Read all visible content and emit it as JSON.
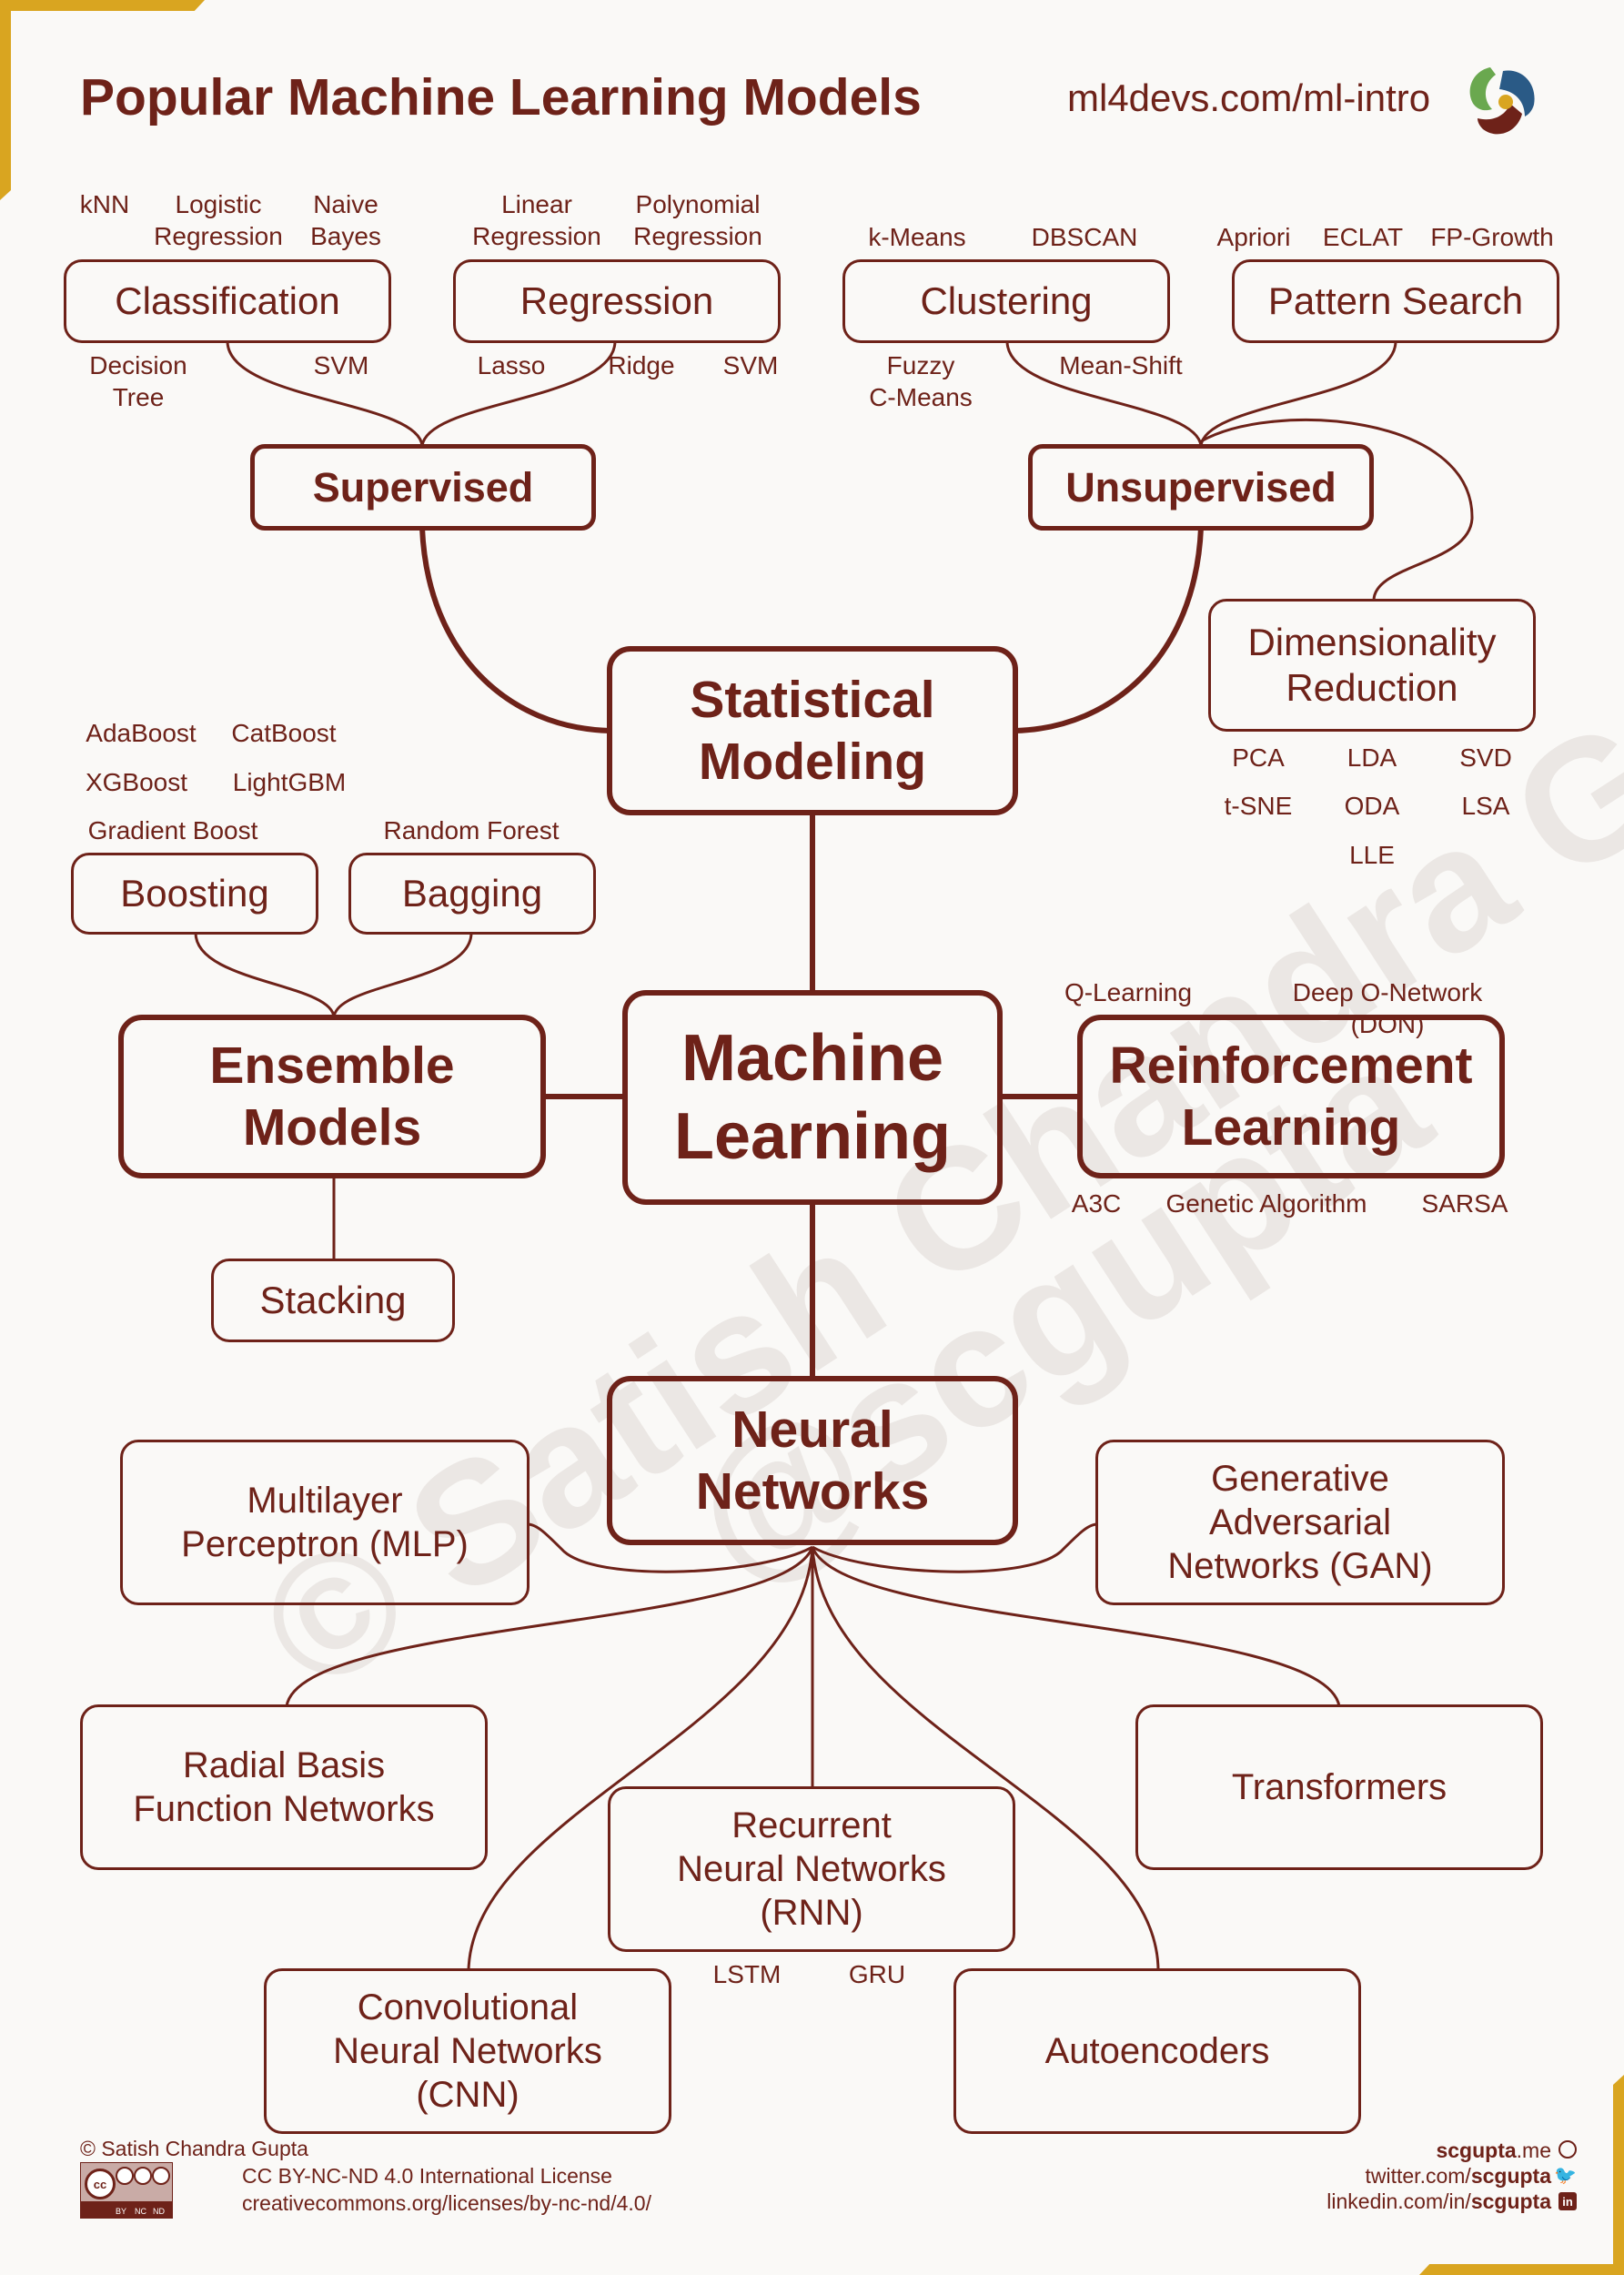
{
  "header": {
    "title": "Popular Machine Learning Models",
    "url": "ml4devs.com/ml-intro",
    "logo_icon": "pinwheel-logo-icon"
  },
  "colors": {
    "primary": "#6e2219",
    "accent_gold": "#d9a520",
    "logo_green": "#6aa84f",
    "logo_blue": "#2a5a86",
    "background": "#faf9f7"
  },
  "watermark": [
    "© Satish Chandra Gupta",
    "@scgupta"
  ],
  "nodes": {
    "machine_learning": "Machine\nLearning",
    "statistical_modeling": "Statistical\nModeling",
    "supervised": "Supervised",
    "unsupervised": "Unsupervised",
    "classification": "Classification",
    "regression": "Regression",
    "clustering": "Clustering",
    "pattern_search": "Pattern Search",
    "dimensionality_reduction": "Dimensionality\nReduction",
    "ensemble_models": "Ensemble\nModels",
    "boosting": "Boosting",
    "bagging": "Bagging",
    "stacking": "Stacking",
    "reinforcement_learning": "Reinforcement\nLearning",
    "neural_networks": "Neural\nNetworks",
    "mlp": "Multilayer\nPerceptron (MLP)",
    "gan": "Generative\nAdversarial\nNetworks (GAN)",
    "rbf": "Radial Basis\nFunction Networks",
    "transformers": "Transformers",
    "rnn": "Recurrent\nNeural Networks\n(RNN)",
    "cnn": "Convolutional\nNeural Networks\n(CNN)",
    "autoencoders": "Autoencoders"
  },
  "labels": {
    "classification": [
      "kNN",
      "Logistic\nRegression",
      "Naive\nBayes",
      "Decision\nTree",
      "SVM"
    ],
    "regression": [
      "Linear\nRegression",
      "Polynomial\nRegression",
      "Lasso",
      "Ridge",
      "SVM"
    ],
    "clustering": [
      "k-Means",
      "DBSCAN",
      "Fuzzy\nC-Means",
      "Mean-Shift"
    ],
    "pattern_search": [
      "Apriori",
      "ECLAT",
      "FP-Growth"
    ],
    "dimensionality_reduction": [
      "PCA",
      "LDA",
      "SVD",
      "t-SNE",
      "ODA",
      "LSA",
      "LLE"
    ],
    "boosting": [
      "AdaBoost",
      "CatBoost",
      "XGBoost",
      "LightGBM",
      "Gradient Boost"
    ],
    "bagging": [
      "Random Forest"
    ],
    "reinforcement": [
      "Q-Learning",
      "Deep O-Network (DON)",
      "A3C",
      "Genetic Algorithm",
      "SARSA"
    ],
    "rnn": [
      "LSTM",
      "GRU"
    ]
  },
  "footer": {
    "copyright": "© Satish Chandra Gupta",
    "license": "CC BY-NC-ND 4.0 International License",
    "license_url": "creativecommons.org/licenses/by-nc-nd/4.0/",
    "cc_badge_labels": [
      "BY",
      "NC",
      "ND"
    ],
    "website_bold": "scgupta",
    "website_rest": ".me",
    "twitter_prefix": "twitter.com/",
    "twitter_handle": "scgupta",
    "linkedin_prefix": "linkedin.com/in/",
    "linkedin_handle": "scgupta"
  }
}
